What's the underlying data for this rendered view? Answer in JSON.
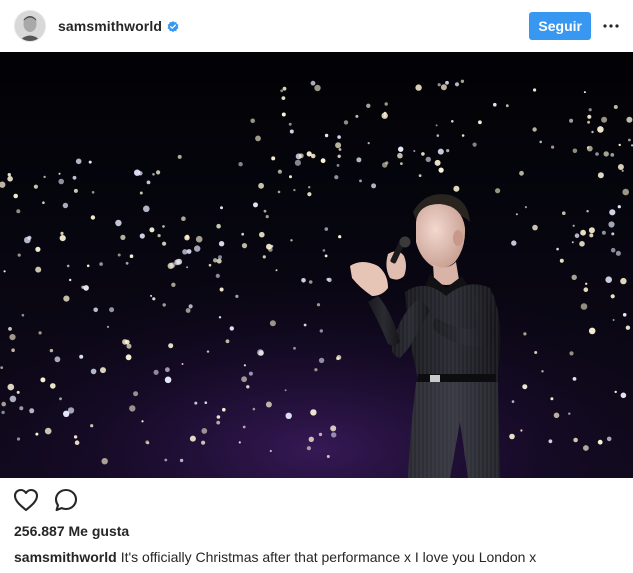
{
  "header": {
    "username": "samsmithworld",
    "verified_icon": "verified-badge-icon",
    "follow_label": "Seguir",
    "more_icon": "more-options-icon"
  },
  "photo": {
    "description_icon": "concert-photo"
  },
  "actions": {
    "like_icon": "heart-icon",
    "comment_icon": "comment-icon"
  },
  "likes": {
    "text": "256.887 Me gusta"
  },
  "caption": {
    "username": "samsmithworld",
    "text": "It's officially Christmas after that performance x I love you London x"
  },
  "colors": {
    "follow_button": "#3897f0",
    "verified": "#3897f0",
    "text": "#262626"
  }
}
